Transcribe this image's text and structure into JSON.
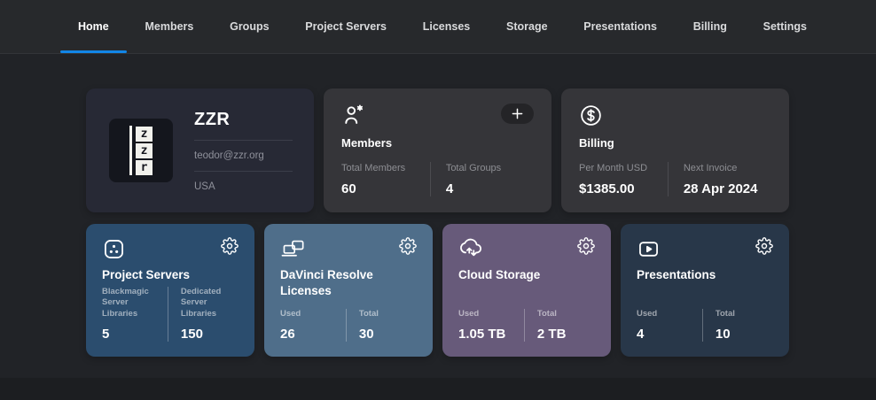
{
  "nav": {
    "items": [
      {
        "label": "Home",
        "active": true
      },
      {
        "label": "Members",
        "active": false
      },
      {
        "label": "Groups",
        "active": false
      },
      {
        "label": "Project Servers",
        "active": false
      },
      {
        "label": "Licenses",
        "active": false
      },
      {
        "label": "Storage",
        "active": false
      },
      {
        "label": "Presentations",
        "active": false
      },
      {
        "label": "Billing",
        "active": false
      },
      {
        "label": "Settings",
        "active": false
      }
    ]
  },
  "profile": {
    "name": "ZZR",
    "email": "teodor@zzr.org",
    "country": "USA",
    "logo_letters": [
      "z",
      "z",
      "r"
    ]
  },
  "members": {
    "title": "Members",
    "stats": [
      {
        "label": "Total Members",
        "value": "60"
      },
      {
        "label": "Total Groups",
        "value": "4"
      }
    ]
  },
  "billing": {
    "title": "Billing",
    "stats": [
      {
        "label": "Per Month USD",
        "value": "$1385.00"
      },
      {
        "label": "Next Invoice",
        "value": "28 Apr 2024"
      }
    ]
  },
  "tiles": [
    {
      "title": "Project Servers",
      "icon": "servers-icon",
      "color": "#2b4d6e",
      "stats": [
        {
          "label": "Blackmagic Server Libraries",
          "value": "5"
        },
        {
          "label": "Dedicated Server Libraries",
          "value": "150"
        }
      ]
    },
    {
      "title": "DaVinci Resolve Licenses",
      "icon": "devices-icon",
      "color": "#4f6e8a",
      "stats": [
        {
          "label": "Used",
          "value": "26"
        },
        {
          "label": "Total",
          "value": "30"
        }
      ]
    },
    {
      "title": "Cloud Storage",
      "icon": "cloud-sync-icon",
      "color": "#675a7a",
      "stats": [
        {
          "label": "Used",
          "value": "1.05 TB"
        },
        {
          "label": "Total",
          "value": "2 TB"
        }
      ]
    },
    {
      "title": "Presentations",
      "icon": "presentation-play-icon",
      "color": "#283749",
      "stats": [
        {
          "label": "Used",
          "value": "4"
        },
        {
          "label": "Total",
          "value": "10"
        }
      ]
    }
  ],
  "colors": {
    "accent_blue": "#1286e8",
    "page_bg": "#212327",
    "nav_bg": "#27292c",
    "card_grey": "#353539",
    "card_profile": "#272935"
  }
}
